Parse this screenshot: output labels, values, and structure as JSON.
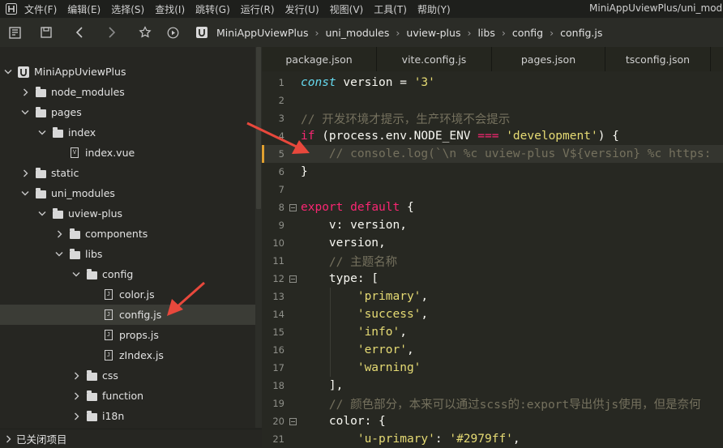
{
  "menubar": {
    "items": [
      "文件(F)",
      "编辑(E)",
      "选择(S)",
      "查找(I)",
      "跳转(G)",
      "运行(R)",
      "发行(U)",
      "视图(V)",
      "工具(T)",
      "帮助(Y)"
    ],
    "window_title": "MiniAppUviewPlus/uni_modul"
  },
  "toolbar": {
    "breadcrumb": [
      "MiniAppUviewPlus",
      "uni_modules",
      "uview-plus",
      "libs",
      "config",
      "config.js"
    ]
  },
  "sidebar": {
    "tree": [
      {
        "label": "MiniAppUviewPlus",
        "type": "project",
        "depth": 0,
        "expanded": true
      },
      {
        "label": "node_modules",
        "type": "folder",
        "depth": 1,
        "expanded": false
      },
      {
        "label": "pages",
        "type": "folder",
        "depth": 1,
        "expanded": true
      },
      {
        "label": "index",
        "type": "folder",
        "depth": 2,
        "expanded": true
      },
      {
        "label": "index.vue",
        "type": "file",
        "depth": 3,
        "badge": "V"
      },
      {
        "label": "static",
        "type": "folder",
        "depth": 1,
        "expanded": false
      },
      {
        "label": "uni_modules",
        "type": "folder",
        "depth": 1,
        "expanded": true
      },
      {
        "label": "uview-plus",
        "type": "folder",
        "depth": 2,
        "expanded": true
      },
      {
        "label": "components",
        "type": "folder",
        "depth": 3,
        "expanded": false
      },
      {
        "label": "libs",
        "type": "folder",
        "depth": 3,
        "expanded": true
      },
      {
        "label": "config",
        "type": "folder",
        "depth": 4,
        "expanded": true
      },
      {
        "label": "color.js",
        "type": "file",
        "depth": 5,
        "badge": "J"
      },
      {
        "label": "config.js",
        "type": "file",
        "depth": 5,
        "badge": "J",
        "selected": true
      },
      {
        "label": "props.js",
        "type": "file",
        "depth": 5,
        "badge": "J"
      },
      {
        "label": "zIndex.js",
        "type": "file",
        "depth": 5,
        "badge": "J"
      },
      {
        "label": "css",
        "type": "folder",
        "depth": 4,
        "expanded": false
      },
      {
        "label": "function",
        "type": "folder",
        "depth": 4,
        "expanded": false
      },
      {
        "label": "i18n",
        "type": "folder",
        "depth": 4,
        "expanded": false
      }
    ],
    "closed_projects_label": "已关闭项目"
  },
  "editor": {
    "tabs": [
      "package.json",
      "vite.config.js",
      "pages.json",
      "tsconfig.json"
    ],
    "lines": [
      {
        "n": "1",
        "tokens": [
          [
            "it",
            "const"
          ],
          [
            "pl",
            " version = "
          ],
          [
            "str",
            "'3'"
          ]
        ]
      },
      {
        "n": "2",
        "tokens": []
      },
      {
        "n": "3",
        "tokens": [
          [
            "cm",
            "// 开发环境才提示，生产环境不会提示"
          ]
        ]
      },
      {
        "n": "4",
        "tokens": [
          [
            "kw",
            "if"
          ],
          [
            "pl",
            " (process.env.NODE_ENV "
          ],
          [
            "kw",
            "==="
          ],
          [
            "pl",
            " "
          ],
          [
            "str",
            "'development'"
          ],
          [
            "pl",
            ") {"
          ]
        ]
      },
      {
        "n": "5",
        "tokens": [
          [
            "cm",
            "    // console.log(`\\n %c uview-plus V${version} %c https:"
          ]
        ],
        "current": true
      },
      {
        "n": "6",
        "tokens": [
          [
            "pl",
            "}"
          ]
        ]
      },
      {
        "n": "7",
        "tokens": []
      },
      {
        "n": "8",
        "tokens": [
          [
            "kw",
            "export"
          ],
          [
            "pl",
            " "
          ],
          [
            "kw",
            "default"
          ],
          [
            "pl",
            " {"
          ]
        ],
        "fold": true
      },
      {
        "n": "9",
        "tokens": [
          [
            "pl",
            "    v: version,"
          ]
        ]
      },
      {
        "n": "10",
        "tokens": [
          [
            "pl",
            "    version,"
          ]
        ]
      },
      {
        "n": "11",
        "tokens": [
          [
            "cm",
            "    // 主题名称"
          ]
        ]
      },
      {
        "n": "12",
        "tokens": [
          [
            "pl",
            "    type: ["
          ]
        ],
        "fold": true
      },
      {
        "n": "13",
        "tokens": [
          [
            "pl",
            "        "
          ],
          [
            "str",
            "'primary'"
          ],
          [
            "pl",
            ","
          ]
        ]
      },
      {
        "n": "14",
        "tokens": [
          [
            "pl",
            "        "
          ],
          [
            "str",
            "'success'"
          ],
          [
            "pl",
            ","
          ]
        ]
      },
      {
        "n": "15",
        "tokens": [
          [
            "pl",
            "        "
          ],
          [
            "str",
            "'info'"
          ],
          [
            "pl",
            ","
          ]
        ]
      },
      {
        "n": "16",
        "tokens": [
          [
            "pl",
            "        "
          ],
          [
            "str",
            "'error'"
          ],
          [
            "pl",
            ","
          ]
        ]
      },
      {
        "n": "17",
        "tokens": [
          [
            "pl",
            "        "
          ],
          [
            "str",
            "'warning'"
          ]
        ]
      },
      {
        "n": "18",
        "tokens": [
          [
            "pl",
            "    ],"
          ]
        ]
      },
      {
        "n": "19",
        "tokens": [
          [
            "cm",
            "    // 颜色部分，本来可以通过scss的:export导出供js使用，但是奈何"
          ]
        ]
      },
      {
        "n": "20",
        "tokens": [
          [
            "pl",
            "    color: {"
          ]
        ],
        "fold": true
      },
      {
        "n": "21",
        "tokens": [
          [
            "pl",
            "        "
          ],
          [
            "str",
            "'u-primary'"
          ],
          [
            "pl",
            ": "
          ],
          [
            "str",
            "'#2979ff'"
          ],
          [
            "pl",
            ","
          ]
        ]
      }
    ]
  },
  "colors": {
    "accent_marker": "#e0a030",
    "arrow": "#e8483c"
  }
}
